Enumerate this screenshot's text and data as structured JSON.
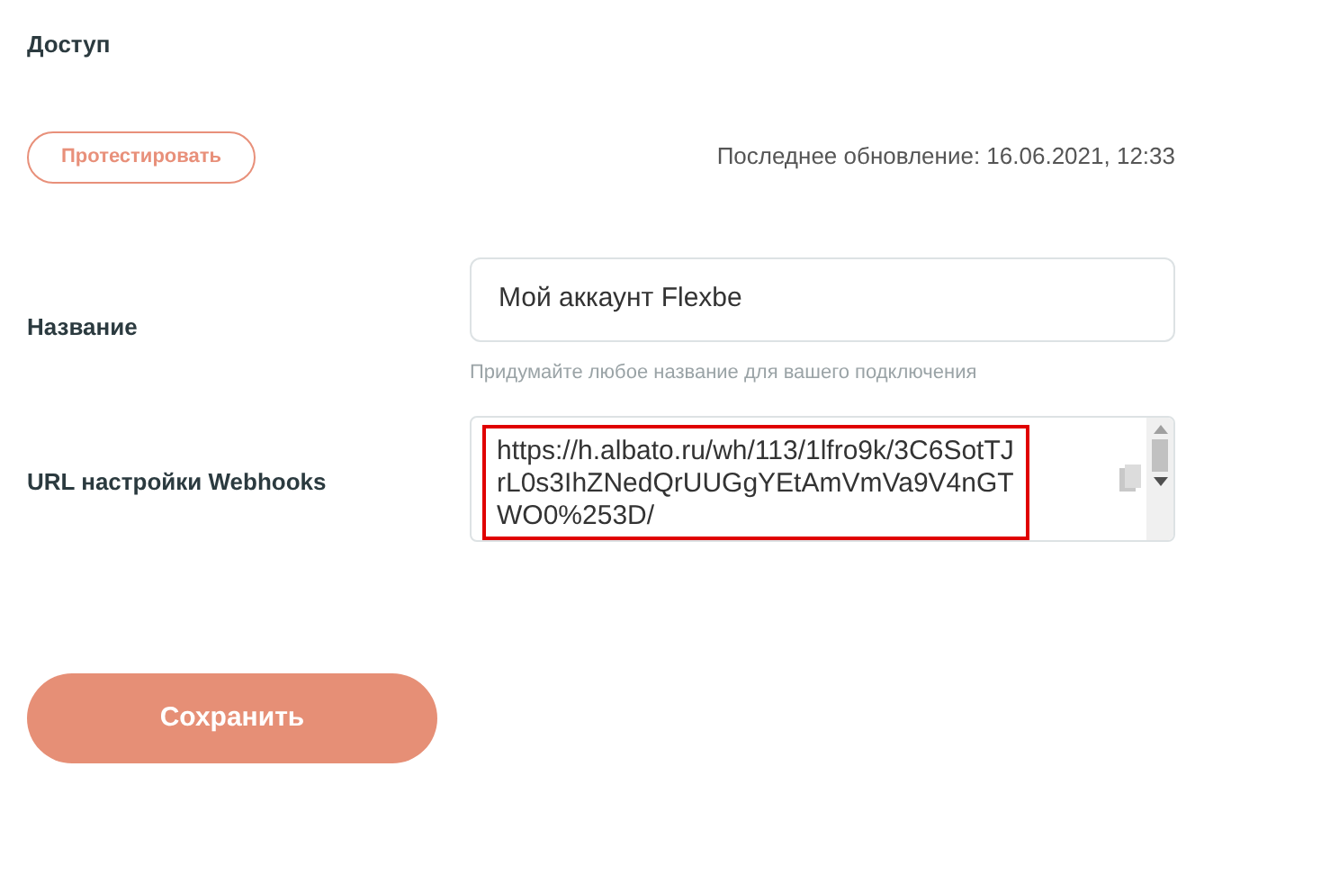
{
  "section_title": "Доступ",
  "test_button": "Протестировать",
  "last_update": "Последнее обновление: 16.06.2021, 12:33",
  "name_field": {
    "label": "Название",
    "value": "Мой аккаунт Flexbe",
    "hint": "Придумайте любое название для вашего подключения"
  },
  "webhook_field": {
    "label": "URL настройки Webhooks",
    "value": "https://h.albato.ru/wh/113/1lfro9k/3C6SotTJrL0s3IhZNedQrUUGgYEtAmVmVa9V4nGTWO0%253D/",
    "highlighted": true
  },
  "save_button": "Сохранить"
}
